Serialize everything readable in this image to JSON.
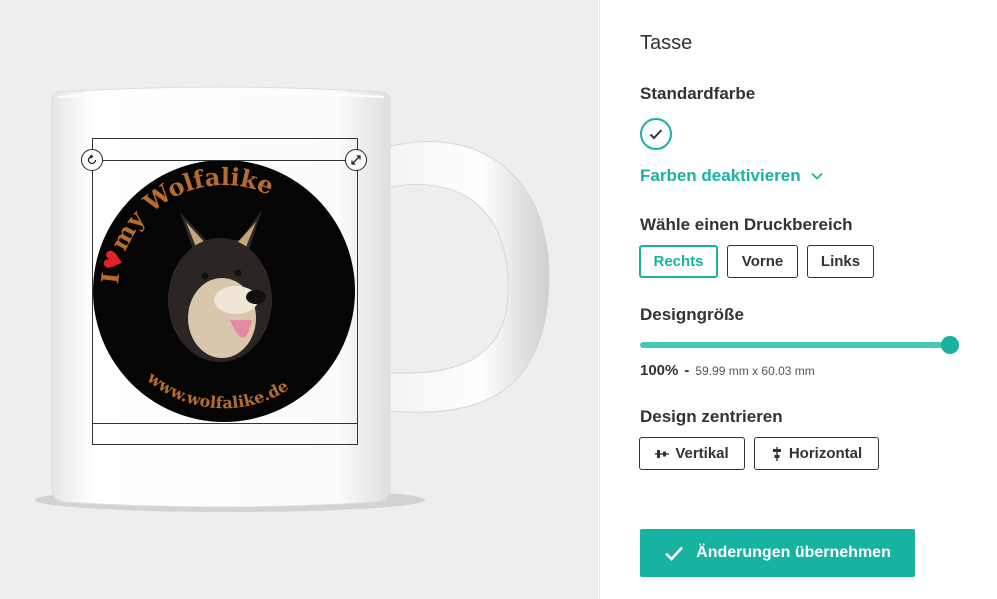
{
  "colors": {
    "accent": "#17b3a0",
    "slider_fill": "#48c9b7",
    "text": "#333333",
    "mug_bg": "#eeeeee"
  },
  "design": {
    "line1": "I",
    "line1b": "my Wolfalike",
    "url": "www.wolfalike.de"
  },
  "handles": {
    "rotate_icon": "rotate-icon",
    "resize_icon": "resize-icon"
  },
  "panel": {
    "title": "Tasse",
    "standard_color_heading": "Standardfarbe",
    "toggle_colors_label": "Farben deaktivieren",
    "print_area_heading": "Wähle einen Druckbereich",
    "print_areas": [
      {
        "label": "Rechts",
        "active": true
      },
      {
        "label": "Vorne",
        "active": false
      },
      {
        "label": "Links",
        "active": false
      }
    ],
    "design_size_heading": "Designgröße",
    "design_size_percent": "100%",
    "design_size_sep": "-",
    "design_size_dims": "59.99 mm x 60.03 mm",
    "slider_value": 1.0,
    "center_heading": "Design zentrieren",
    "center_vertical": "Vertikal",
    "center_horizontal": "Horizontal",
    "apply_label": "Änderungen übernehmen"
  }
}
